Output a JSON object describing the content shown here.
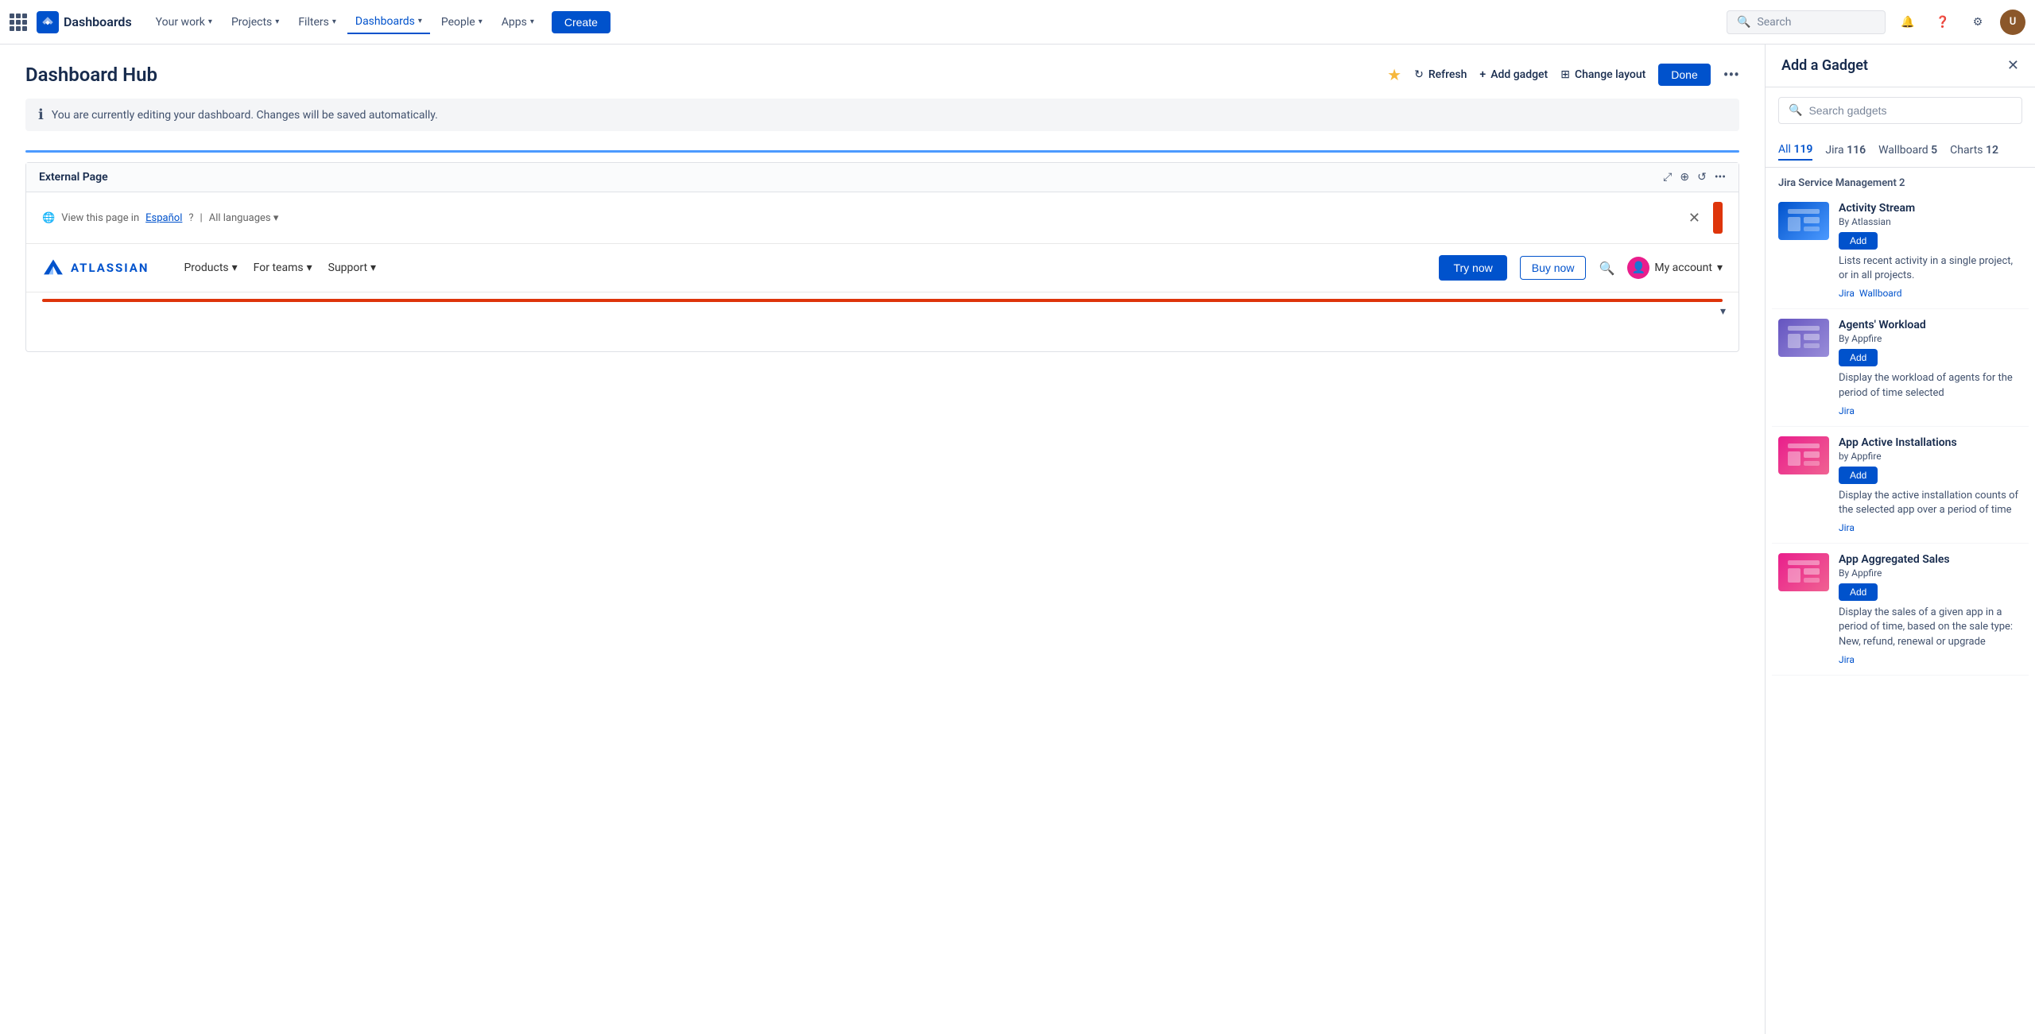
{
  "nav": {
    "your_work": "Your work",
    "projects": "Projects",
    "filters": "Filters",
    "dashboards": "Dashboards",
    "people": "People",
    "apps": "Apps",
    "create": "Create",
    "search_placeholder": "Search"
  },
  "dashboard": {
    "title": "Dashboard Hub",
    "refresh": "Refresh",
    "add_gadget": "Add gadget",
    "change_layout": "Change layout",
    "done": "Done",
    "editing_message": "You are currently editing your dashboard. Changes will be saved automatically."
  },
  "external_page": {
    "title": "External Page",
    "lang_bar": "View this page in",
    "spanish": "Español",
    "all_languages": "All languages",
    "atlassian_label": "ATLASSIAN",
    "products": "Products",
    "for_teams": "For teams",
    "support": "Support",
    "try_now": "Try now",
    "buy_now": "Buy now",
    "my_account": "My account"
  },
  "right_panel": {
    "title": "Add a Gadget",
    "search_placeholder": "Search gadgets",
    "filters": [
      {
        "label": "All",
        "count": "119",
        "active": true
      },
      {
        "label": "Jira",
        "count": "116",
        "active": false
      },
      {
        "label": "Wallboard",
        "count": "5",
        "active": false
      },
      {
        "label": "Charts",
        "count": "12",
        "active": false
      }
    ],
    "section_label": "Jira Service Management 2",
    "gadgets": [
      {
        "name": "Activity Stream",
        "by": "By Atlassian",
        "add_label": "Add",
        "description": "Lists recent activity in a single project, or in all projects.",
        "tags": [
          "Jira",
          "Wallboard"
        ],
        "thumb_type": "blue"
      },
      {
        "name": "Agents' Workload",
        "by": "By Appfire",
        "add_label": "Add",
        "description": "Display the workload of agents for the period of time selected",
        "tags": [
          "Jira"
        ],
        "thumb_type": "purple"
      },
      {
        "name": "App Active Installations",
        "by": "by Appfire",
        "add_label": "Add",
        "description": "Display the active installation counts of the selected app over a period of time",
        "tags": [
          "Jira"
        ],
        "thumb_type": "pink"
      },
      {
        "name": "App Aggregated Sales",
        "by": "By Appfire",
        "add_label": "Add",
        "description": "Display the sales of a given app in a period of time, based on the sale type: New, refund, renewal or upgrade",
        "tags": [
          "Jira"
        ],
        "thumb_type": "pink"
      }
    ]
  }
}
